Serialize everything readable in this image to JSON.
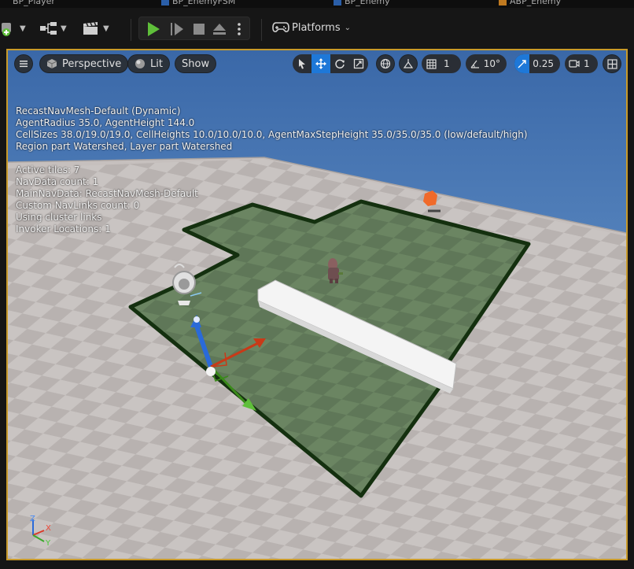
{
  "tabs": [
    {
      "label": "BP_Player"
    },
    {
      "label": "BP_EnemyFSM"
    },
    {
      "label": "BP_Enemy"
    },
    {
      "label": "ABP_Enemy"
    }
  ],
  "toolbar": {
    "platforms_label": "Platforms"
  },
  "viewport": {
    "perspective_label": "Perspective",
    "lit_label": "Lit",
    "show_label": "Show",
    "grid_snap_value": "1",
    "rotation_snap_value": "10°",
    "scale_snap_value": "0.25",
    "camera_speed_value": "1"
  },
  "navmesh_info": {
    "line1": "RecastNavMesh-Default (Dynamic)",
    "line2": "AgentRadius 35.0, AgentHeight 144.0",
    "line3": "CellSizes 38.0/19.0/19.0, CellHeights 10.0/10.0/10.0, AgentMaxStepHeight 35.0/35.0/35.0 (low/default/high)",
    "line4": "Region part Watershed, Layer part Watershed",
    "line5": "Active tiles: 7",
    "line6": "NavData count: 1",
    "line7": "MainNavData: RecastNavMesh-Default",
    "line8": "Custom NavLinks count: 0",
    "line9": "Using cluster links",
    "line10": "Invoker Locations: 1"
  },
  "axis_labels": {
    "z": "Z",
    "x": "X",
    "y": "Y"
  },
  "colors": {
    "accent": "#1e78d8",
    "play_green": "#5fbf3a",
    "viewport_border": "#c89a2a",
    "navmesh": "#5a7a4a",
    "navmesh_edge": "#1a3a14",
    "sky": "#4a78b8"
  }
}
